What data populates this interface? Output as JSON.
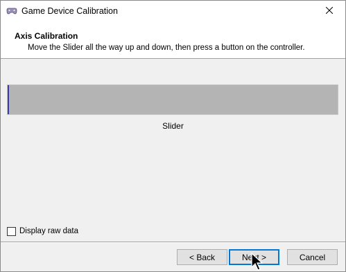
{
  "window": {
    "title": "Game Device Calibration",
    "icon": "game-controller-icon"
  },
  "header": {
    "title": "Axis Calibration",
    "subtitle": "Move the Slider all the way up and down, then press a button on the controller."
  },
  "slider": {
    "label": "Slider",
    "position_fraction": 0.0,
    "bar_color": "#b4b4b4",
    "indicator_color": "#3a3aa8"
  },
  "raw_data": {
    "label": "Display raw data",
    "checked": false
  },
  "buttons": {
    "back": "< Back",
    "next": "Next >",
    "cancel": "Cancel"
  },
  "accent_color": "#0078d7"
}
